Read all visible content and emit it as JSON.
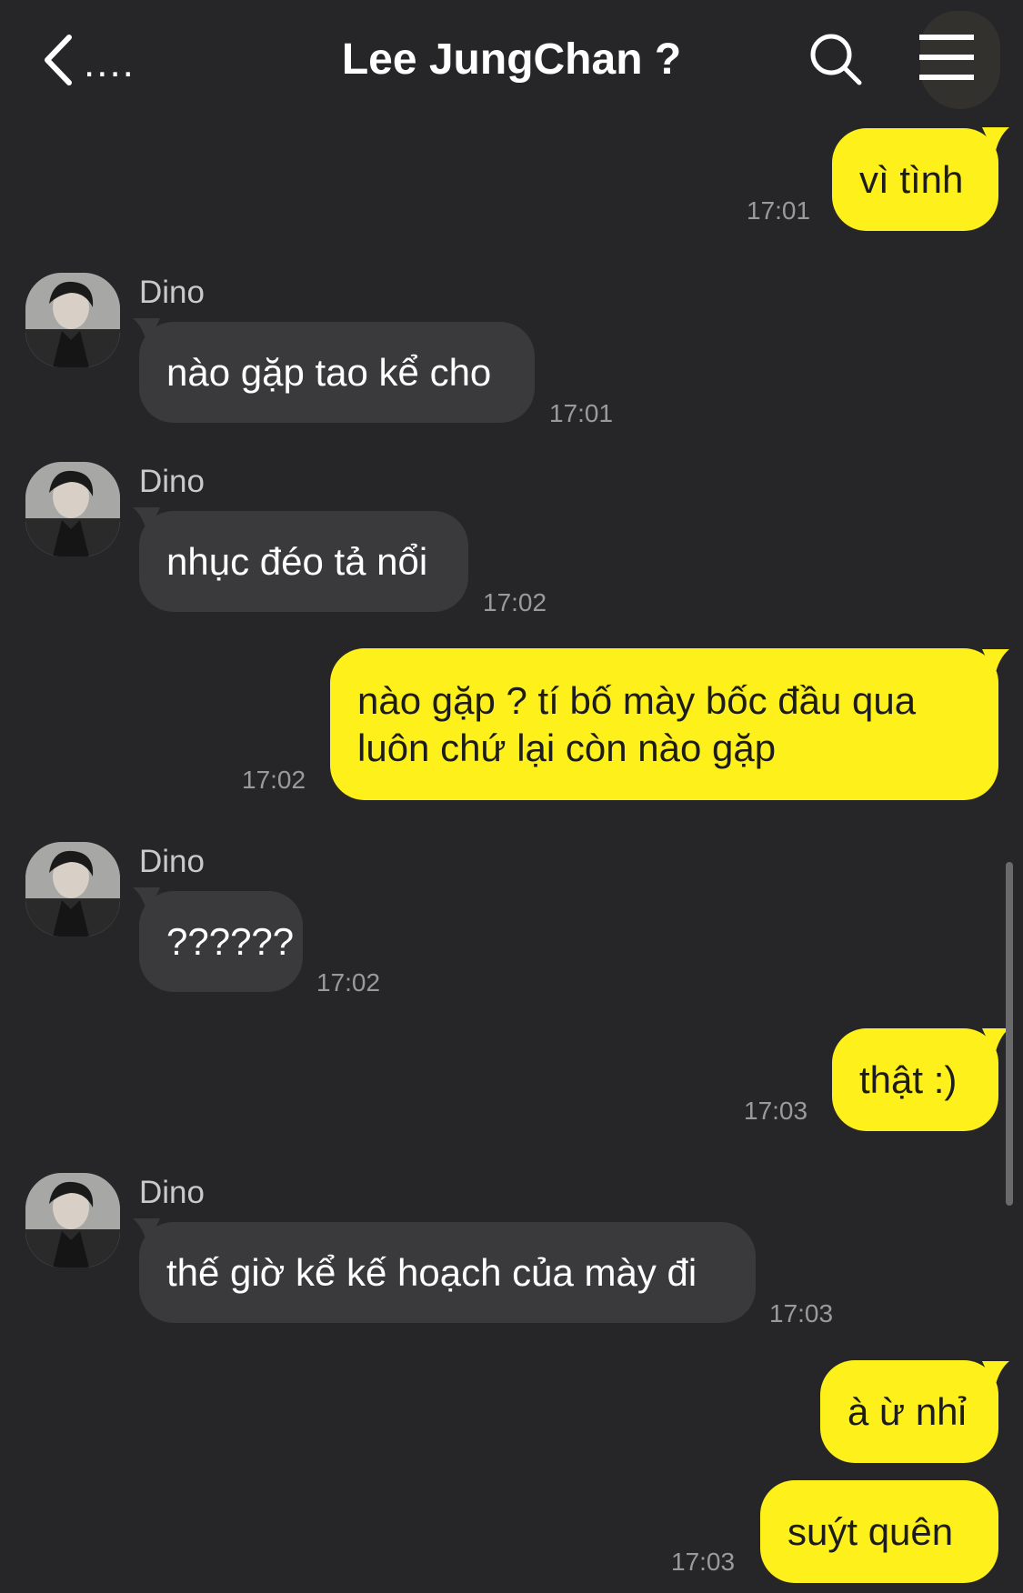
{
  "header": {
    "back_label": "....",
    "title": "Lee JungChan ?"
  },
  "colors": {
    "background": "#262628",
    "outgoing_bubble": "#fef01b",
    "incoming_bubble": "#3a3a3d"
  },
  "messages": [
    {
      "direction": "out",
      "text": "vì tình",
      "time": "17:01"
    },
    {
      "direction": "in",
      "sender": "Dino",
      "text": "nào gặp tao kể cho",
      "time": "17:01"
    },
    {
      "direction": "in",
      "sender": "Dino",
      "text": "nhục đéo tả nổi",
      "time": "17:02"
    },
    {
      "direction": "out",
      "text_line1": "nào gặp ? tí bố mày bốc đầu qua",
      "text_line2": "luôn chứ lại còn nào gặp",
      "time": "17:02"
    },
    {
      "direction": "in",
      "sender": "Dino",
      "text": "??????",
      "time": "17:02"
    },
    {
      "direction": "out",
      "text": "thật :)",
      "time": "17:03"
    },
    {
      "direction": "in",
      "sender": "Dino",
      "text": "thế giờ kể kế hoạch của mày đi",
      "time": "17:03"
    },
    {
      "direction": "out",
      "text": "à ừ nhỉ"
    },
    {
      "direction": "out",
      "text": "suýt quên",
      "time": "17:03"
    }
  ]
}
